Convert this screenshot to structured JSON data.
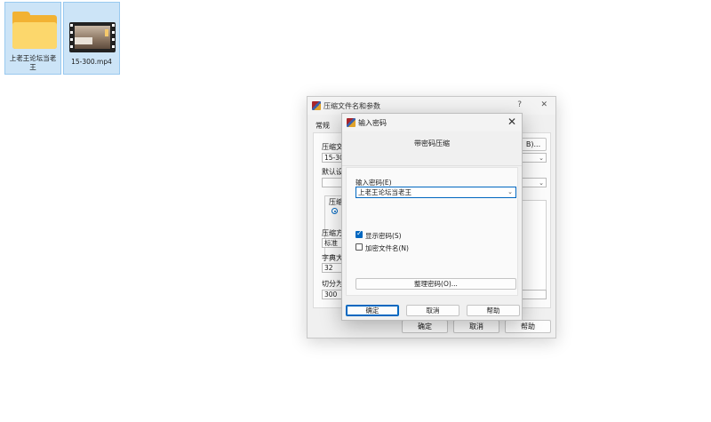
{
  "desktop": {
    "icons": [
      {
        "label": "上老王论坛当老王",
        "type": "folder"
      },
      {
        "label": "15-300.mp4",
        "type": "video"
      }
    ]
  },
  "parent_dialog": {
    "title": "压缩文件名和参数",
    "help_glyph": "?",
    "close_glyph": "✕",
    "tab_general": "常规",
    "archive_name_label": "压缩文",
    "archive_name_value": "15-300",
    "browse_button": "B)...",
    "default_profile_label": "默认设",
    "format_group_label": "压缩",
    "method_label": "压缩方",
    "method_value": "标准",
    "dict_label": "字典大",
    "dict_value": "32",
    "split_label": "切分为",
    "split_value": "300",
    "ok_button": "确定",
    "cancel_button": "取消",
    "help_button": "帮助"
  },
  "password_dialog": {
    "title": "输入密码",
    "close_glyph": "✕",
    "header": "带密码压缩",
    "password_label": "输入密码(E)",
    "password_value": "上老王论坛当老王",
    "show_password_label": "显示密码(S)",
    "show_password_checked": true,
    "encrypt_names_label": "加密文件名(N)",
    "encrypt_names_checked": false,
    "manage_button": "整理密码(O)...",
    "ok_button": "确定",
    "cancel_button": "取消",
    "help_button": "帮助"
  },
  "colors": {
    "accent": "#0067c0",
    "folder": "#f2b233",
    "selection": "#cce4f7"
  }
}
